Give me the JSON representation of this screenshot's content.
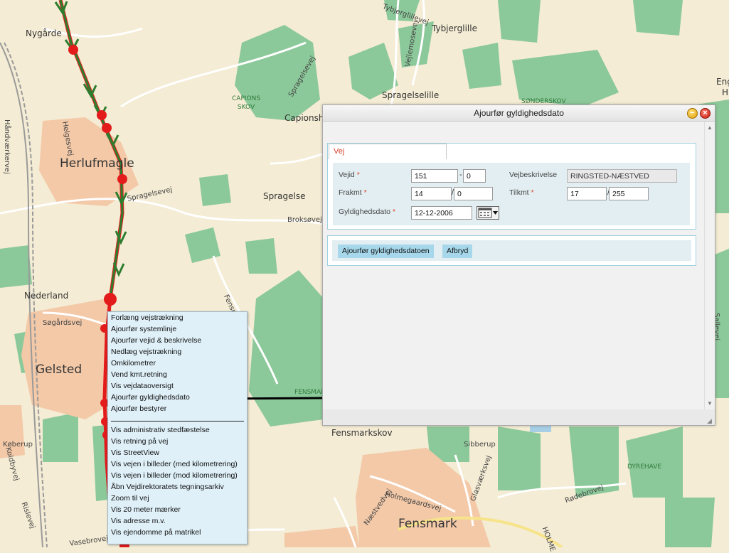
{
  "map": {
    "places": {
      "nygaarde": "Nygårde",
      "herlufmagle": "Herlufmagle",
      "gelsted": "Gelsted",
      "nederland": "Nederland",
      "spragelse": "Spragelse",
      "spragelselille": "Spragelselille",
      "tybjerglille": "Tybjerglille",
      "capionshus": "Capionshu",
      "fensmarkskov": "Fensmarkskov",
      "fensmark": "Fensmark",
      "koberup": "Køberup",
      "sibberup": "Sibberup",
      "eng": "Eng",
      "h": "H"
    },
    "forests": {
      "capions_skov": "CAPIONS\nSKOV",
      "sonderskov": "SØNDERSKOV",
      "fensmark_forest": "FENSMAR",
      "dyrehave": "DYREHAVE"
    },
    "roads": {
      "spragelsevej_a": "Spragelsevej",
      "spragelsevej_b": "Spragelsevej",
      "broksoevej": "Broksøvej",
      "sogardsvej": "Søgårdsvej",
      "helgesvej": "Helgesvej",
      "handvaerkervej": "Håndværkervej",
      "vejlemosevej": "Vejlemosevej",
      "tybjerglillevej": "Tybjerglillevej",
      "holmegaardsvej": "Holmegaardsvej",
      "naestvedvej": "Næstvedvej",
      "glasvaerksvej": "Glasværksvej",
      "rodebrovej": "Rødebrovej",
      "koldbyvej": "Koldbyvej",
      "rislevej": "Rislevej",
      "vasebrovej": "Vasebrovej",
      "fensmarkvej": "Fensmarkvej",
      "holme": "HOLME",
      "sallevej": "Sallevej"
    }
  },
  "context_menu": {
    "items_top": [
      "Forlæng vejstrækning",
      "Ajourfør systemlinje",
      "Ajourfør vejid & beskrivelse",
      "Nedlæg vejstrækning",
      "Omkilometrer",
      "Vend kmt.retning",
      "Vis vejdataoversigt",
      "Ajourfør gyldighedsdato",
      "Ajourfør bestyrer"
    ],
    "items_bottom": [
      "Vis administrativ stedfæstelse",
      "Vis retning på vej",
      "Vis StreetView",
      "Vis vejen i billeder (med kilometrering)",
      "Vis vejen i billeder (mod kilometrering)",
      "Åbn Vejdirektoratets tegningsarkiv",
      "Zoom til vej",
      "Vis 20 meter mærker",
      "Vis adresse m.v.",
      "Vis ejendomme på matrikel"
    ]
  },
  "dialog": {
    "title": "Ajourfør gyldighedsdato",
    "tab_label": "Vej",
    "form": {
      "vejid_label": "Vejid",
      "vejid_value": "151",
      "vejid_sub_value": "0",
      "vejbeskrivelse_label": "Vejbeskrivelse",
      "vejbeskrivelse_value": "RINGSTED-NÆSTVED",
      "frakmt_label": "Frakmt",
      "frakmt_value": "14",
      "frakmt_sub_value": "0",
      "tilkmt_label": "Tilkmt",
      "tilkmt_value": "17",
      "tilkmt_sub_value": "255",
      "gyldighedsdato_label": "Gyldighedsdato",
      "gyldighedsdato_value": "12-12-2006",
      "required_marker": "*",
      "dash": "-",
      "slash": "/"
    },
    "buttons": {
      "submit": "Ajourfør gyldighedsdatoen",
      "cancel": "Afbryd"
    }
  },
  "colors": {
    "map_bg": "#f4ecd4",
    "forest": "#8cc99a",
    "town": "#f3c9a8",
    "route_green": "#2e7d2e",
    "route_red": "#e31b1b",
    "required": "#d9432a",
    "button": "#a6d7ea",
    "menu_bg": "#dff0f8"
  }
}
